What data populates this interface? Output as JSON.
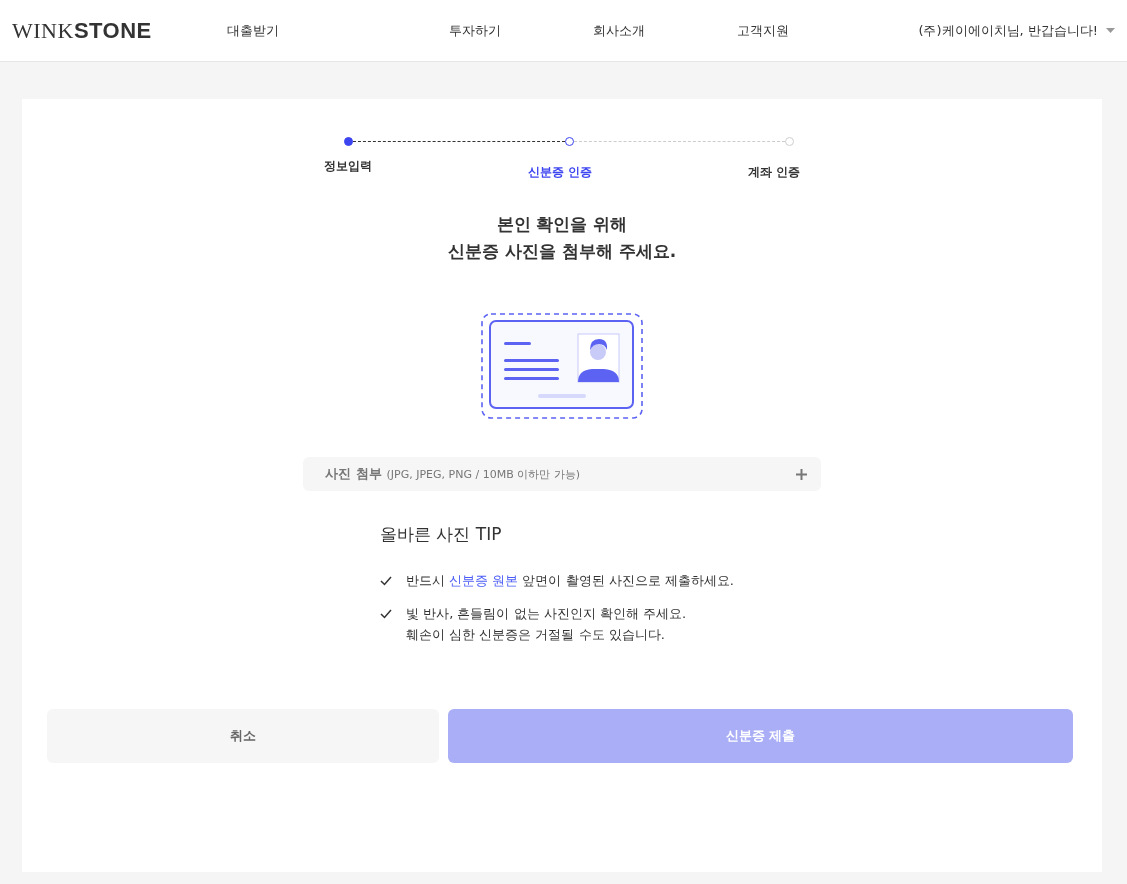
{
  "header": {
    "logo": "WINK**STONE**",
    "nav": [
      {
        "label": "대출받기"
      },
      {
        "label": "투자하기"
      },
      {
        "label": "회사소개"
      },
      {
        "label": "고객지원"
      }
    ],
    "user_menu": "(주)케이에이치님, 반갑습니다!"
  },
  "steps": [
    {
      "label": "정보입력",
      "done": true,
      "selected": false
    },
    {
      "label": "신분증 인증",
      "done": false,
      "selected": true
    },
    {
      "label": "계좌 인증",
      "done": false,
      "selected": false
    }
  ],
  "title": [
    "본인 확인을 위해",
    "신분증 사진을 첨부해 주세요."
  ],
  "upload": {
    "label": "사진 첨부",
    "hint": "(JPG, JPEG, PNG / 10MB 이하만 가능)"
  },
  "tips": {
    "title": "올바른 사진 TIP",
    "items": [
      {
        "lines": [
          [
            {
              "text": "반드시 ",
              "highlight": false
            },
            {
              "text": "신분증 원본",
              "highlight": true
            },
            {
              "text": " 앞면이 촬영된 사진으로 제출하세요.",
              "highlight": false
            }
          ]
        ]
      },
      {
        "lines": [
          [
            {
              "text": "빛 반사, 흔들림이 없는 사진인지 확인해 주세요.",
              "highlight": false
            }
          ],
          [
            {
              "text": "훼손이 심한 신분증은 거절될 수도 있습니다.",
              "highlight": false
            }
          ]
        ]
      }
    ]
  },
  "buttons": {
    "cancel": {
      "label": "취소"
    },
    "submit": {
      "label": "신분증 제출",
      "disabled": true
    }
  }
}
